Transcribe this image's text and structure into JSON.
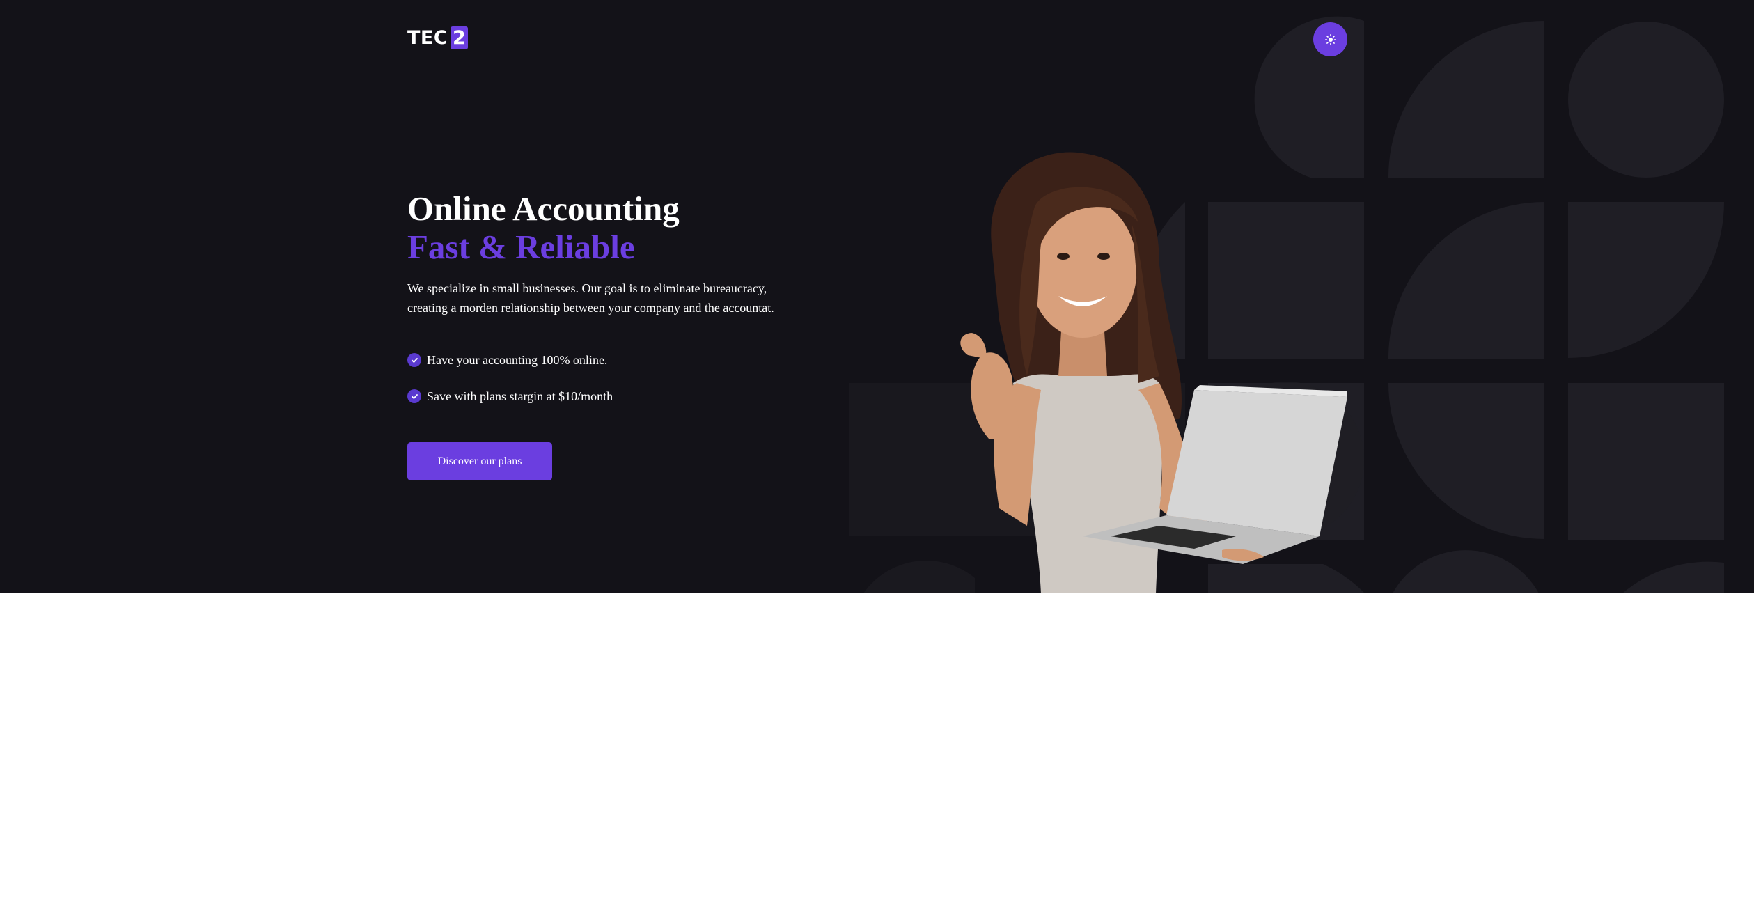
{
  "header": {
    "logo_text": "TEC",
    "logo_badge": "2",
    "theme_toggle_icon": "sun-icon"
  },
  "hero": {
    "title_line1": "Online Accounting",
    "title_line2": "Fast & Reliable",
    "description": "We specialize in small businesses. Our goal is to eliminate bureaucracy, creating a morden relationship between your company and the accountat.",
    "features": [
      "Have your accounting 100% online.",
      "Save with plans stargin at $10/month"
    ],
    "cta_label": "Discover our plans",
    "image_subject": "smiling woman holding laptop, thumbs pointing back"
  },
  "colors": {
    "background": "#131218",
    "accent": "#6b3ee0",
    "text": "#ffffff",
    "pattern": "#1f1e25"
  }
}
